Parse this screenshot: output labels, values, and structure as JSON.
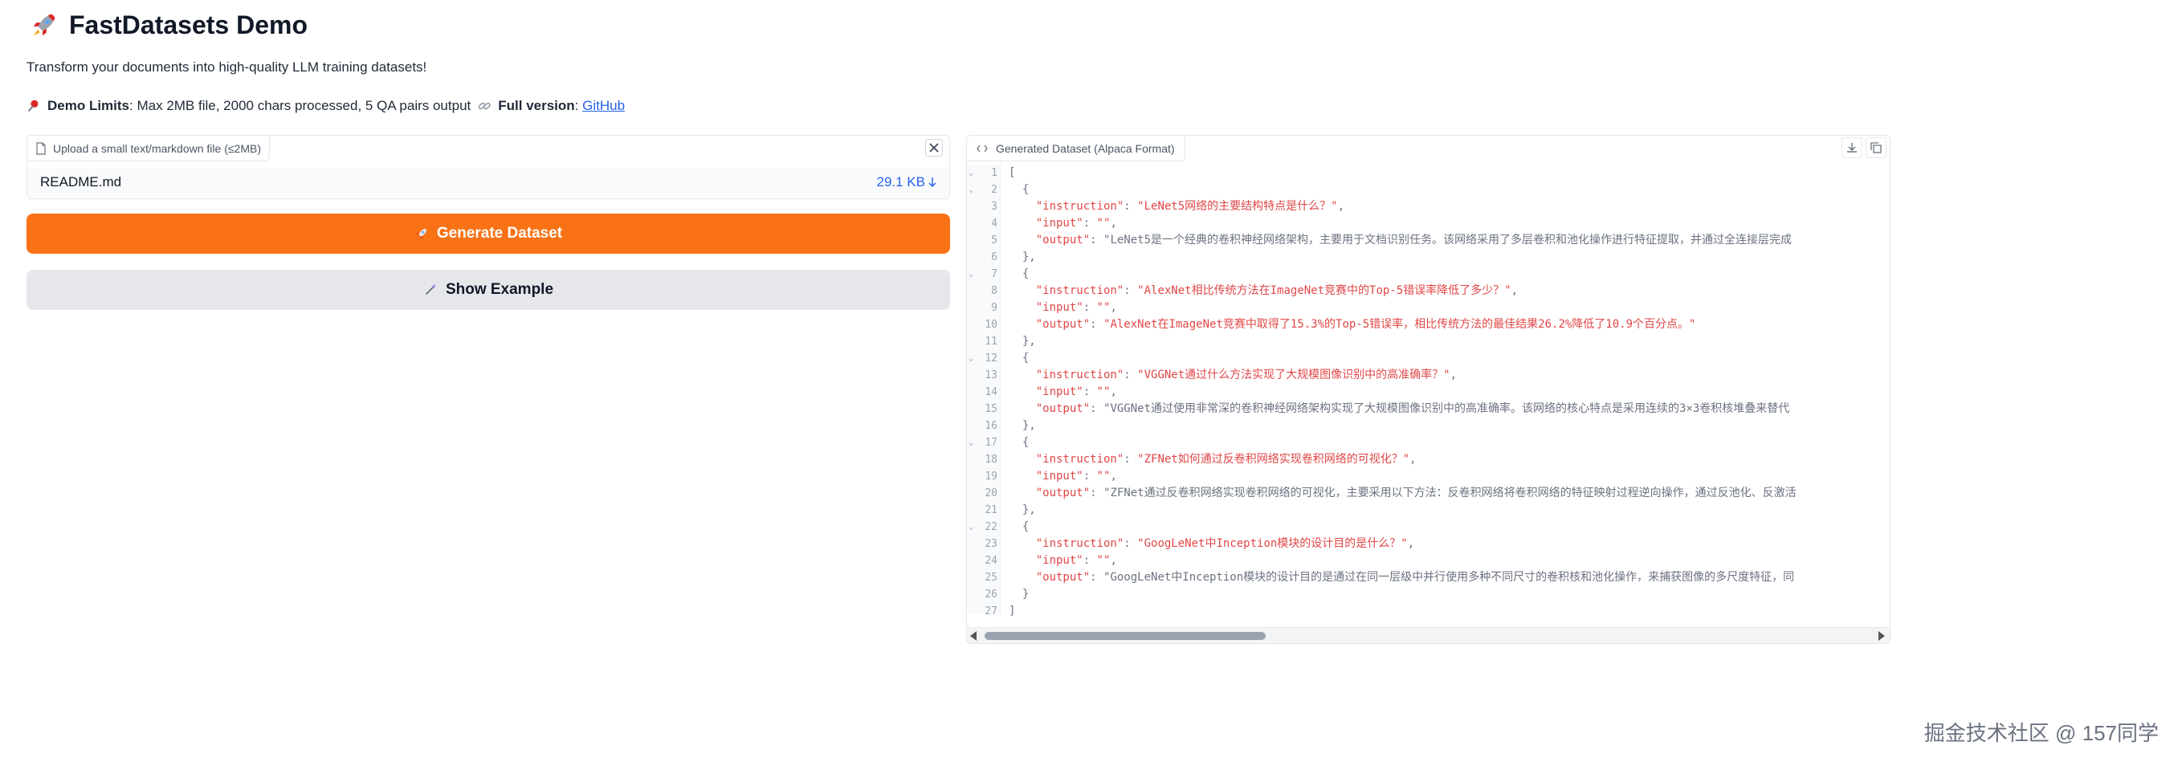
{
  "header": {
    "title": "FastDatasets Demo",
    "icon": "rocket-icon",
    "subtitle": "Transform your documents into high-quality LLM training datasets!"
  },
  "limits": {
    "demo_label": "Demo Limits",
    "demo_text": ": Max 2MB file, 2000 chars processed, 5 QA pairs output",
    "full_label": "Full version",
    "full_sep": ": ",
    "github_link": "GitHub"
  },
  "upload": {
    "label": "Upload a small text/markdown file (≤2MB)",
    "file_name": "README.md",
    "file_size": "29.1 KB"
  },
  "buttons": {
    "generate": "Generate Dataset",
    "example": "Show Example"
  },
  "output": {
    "label": "Generated Dataset (Alpaca Format)",
    "lines": [
      "[",
      "  {",
      "    \"instruction\": \"LeNet5网络的主要结构特点是什么？\",",
      "    \"input\": \"\",",
      "    \"output\": \"LeNet5是一个经典的卷积神经网络架构，主要用于文档识别任务。该网络采用了多层卷积和池化操作进行特征提取，并通过全连接层完成",
      "  },",
      "  {",
      "    \"instruction\": \"AlexNet相比传统方法在ImageNet竞赛中的Top-5错误率降低了多少？\",",
      "    \"input\": \"\",",
      "    \"output\": \"AlexNet在ImageNet竞赛中取得了15.3%的Top-5错误率，相比传统方法的最佳结果26.2%降低了10.9个百分点。\"",
      "  },",
      "  {",
      "    \"instruction\": \"VGGNet通过什么方法实现了大规模图像识别中的高准确率？\",",
      "    \"input\": \"\",",
      "    \"output\": \"VGGNet通过使用非常深的卷积神经网络架构实现了大规模图像识别中的高准确率。该网络的核心特点是采用连续的3×3卷积核堆叠来替代",
      "  },",
      "  {",
      "    \"instruction\": \"ZFNet如何通过反卷积网络实现卷积网络的可视化？\",",
      "    \"input\": \"\",",
      "    \"output\": \"ZFNet通过反卷积网络实现卷积网络的可视化，主要采用以下方法：反卷积网络将卷积网络的特征映射过程逆向操作，通过反池化、反激活",
      "  },",
      "  {",
      "    \"instruction\": \"GoogLeNet中Inception模块的设计目的是什么？\",",
      "    \"input\": \"\",",
      "    \"output\": \"GoogLeNet中Inception模块的设计目的是通过在同一层级中并行使用多种不同尺寸的卷积核和池化操作，来捕获图像的多尺度特征，同",
      "  }",
      "]"
    ],
    "fold_lines": [
      1,
      2,
      7,
      12,
      17,
      22
    ]
  },
  "watermark": "掘金技术社区 @ 157同学"
}
